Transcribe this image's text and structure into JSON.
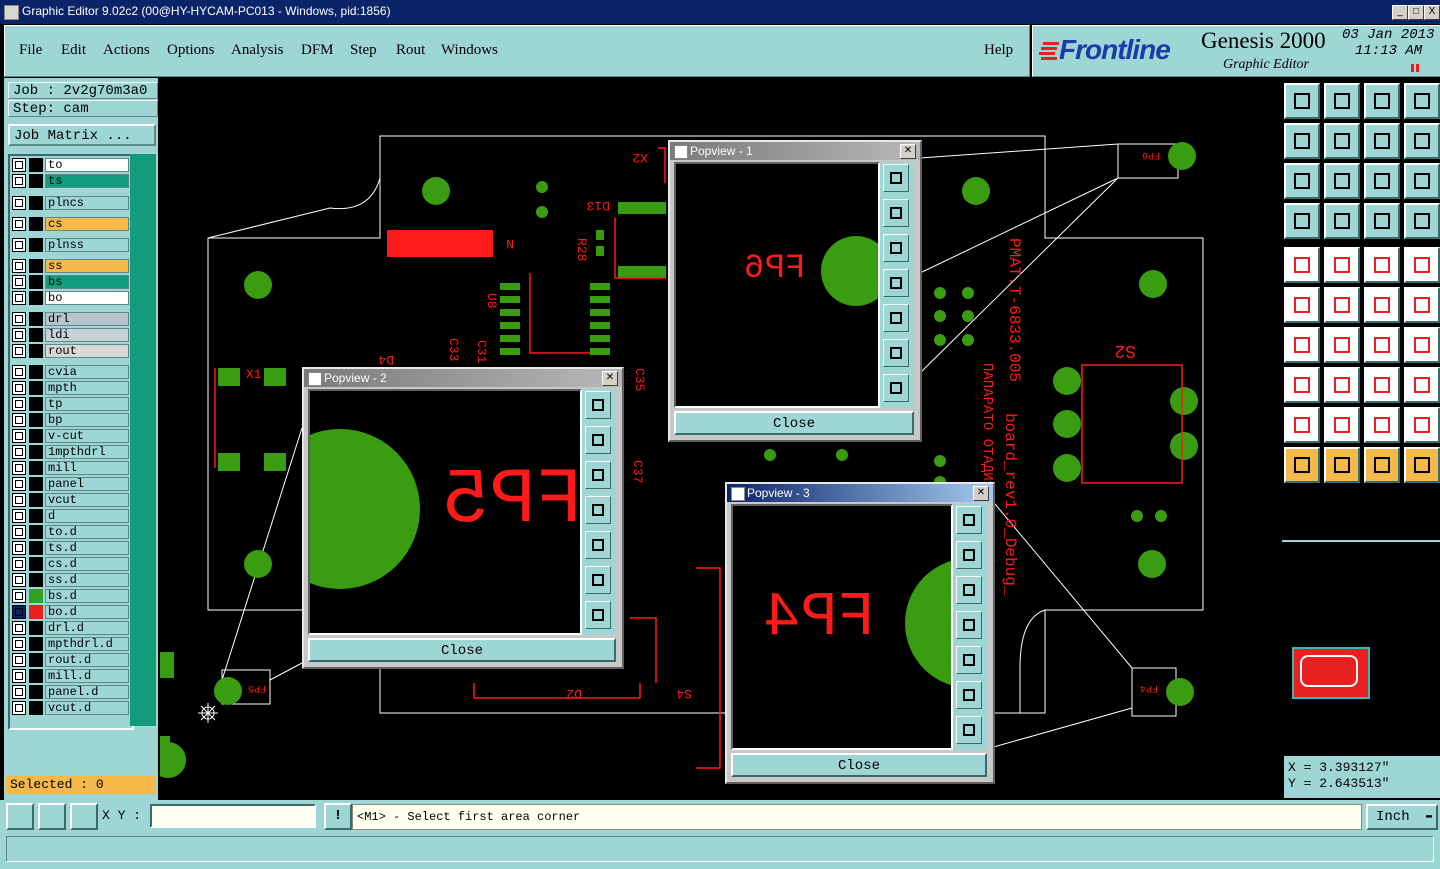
{
  "window": {
    "title": "Graphic Editor 9.02c2 (00@HY-HYCAM-PC013 - Windows, pid:1856)",
    "minimize": "_",
    "maximize": "□",
    "close": "X"
  },
  "menu": {
    "items": [
      "File",
      "Edit",
      "Actions",
      "Options",
      "Analysis",
      "DFM",
      "Step",
      "Rout",
      "Windows"
    ],
    "help": "Help"
  },
  "brand": {
    "logo": "Frontline",
    "product": "Genesis 2000",
    "subtitle": "Graphic Editor",
    "date": "03 Jan 2013",
    "time": "11:13 AM"
  },
  "job": {
    "job_label": "Job : 2v2g70m3a0",
    "step_label": "Step: cam",
    "matrix_button": "Job Matrix ..."
  },
  "layers": [
    {
      "name": "to",
      "color": "#ffffff",
      "sw": "#000000"
    },
    {
      "name": "ts",
      "color": "#139c7c",
      "sw": "#000000"
    },
    {
      "name": "plncs",
      "color": "#9ed6d6",
      "sw": "#000000"
    },
    {
      "name": "cs",
      "color": "#f5b84a",
      "sw": "#000000"
    },
    {
      "name": "plnss",
      "color": "#9ed6d6",
      "sw": "#000000"
    },
    {
      "name": "ss",
      "color": "#f5b84a",
      "sw": "#000000"
    },
    {
      "name": "bs",
      "color": "#139c7c",
      "sw": "#000000"
    },
    {
      "name": "bo",
      "color": "#ffffff",
      "sw": "#000000"
    },
    {
      "name": "drl",
      "color": "#b8c4cc",
      "sw": "#000000"
    },
    {
      "name": "ldi",
      "color": "#c8d0d8",
      "sw": "#000000"
    },
    {
      "name": "rout",
      "color": "#d8d8d8",
      "sw": "#000000"
    },
    {
      "name": "cvia",
      "color": "#9ed6d6",
      "sw": "#000000"
    },
    {
      "name": "mpth",
      "color": "#9ed6d6",
      "sw": "#000000"
    },
    {
      "name": "tp",
      "color": "#9ed6d6",
      "sw": "#000000"
    },
    {
      "name": "bp",
      "color": "#9ed6d6",
      "sw": "#000000"
    },
    {
      "name": "v-cut",
      "color": "#9ed6d6",
      "sw": "#000000"
    },
    {
      "name": "1mpthdrl",
      "color": "#9ed6d6",
      "sw": "#000000"
    },
    {
      "name": "mill",
      "color": "#9ed6d6",
      "sw": "#000000"
    },
    {
      "name": "panel",
      "color": "#9ed6d6",
      "sw": "#000000"
    },
    {
      "name": "vcut",
      "color": "#9ed6d6",
      "sw": "#000000"
    },
    {
      "name": "d",
      "color": "#9ed6d6",
      "sw": "#000000"
    },
    {
      "name": "to.d",
      "color": "#9ed6d6",
      "sw": "#000000"
    },
    {
      "name": "ts.d",
      "color": "#9ed6d6",
      "sw": "#000000"
    },
    {
      "name": "cs.d",
      "color": "#9ed6d6",
      "sw": "#000000"
    },
    {
      "name": "ss.d",
      "color": "#9ed6d6",
      "sw": "#000000"
    },
    {
      "name": "bs.d",
      "color": "#9ed6d6",
      "sw": "#33a020"
    },
    {
      "name": "bo.d",
      "color": "#9ed6d6",
      "sw": "#e82020"
    },
    {
      "name": "drl.d",
      "color": "#9ed6d6",
      "sw": "#000000"
    },
    {
      "name": "mpthdrl.d",
      "color": "#9ed6d6",
      "sw": "#000000"
    },
    {
      "name": "rout.d",
      "color": "#9ed6d6",
      "sw": "#000000"
    },
    {
      "name": "mill.d",
      "color": "#9ed6d6",
      "sw": "#000000"
    },
    {
      "name": "panel.d",
      "color": "#9ed6d6",
      "sw": "#000000"
    },
    {
      "name": "vcut.d",
      "color": "#9ed6d6",
      "sw": "#000000"
    }
  ],
  "selected_label": "Selected : 0",
  "canvas_labels": {
    "x2": "X2",
    "d13": "D13",
    "r28": "R28",
    "u8": "U8",
    "c33": "C33",
    "c31": "C31",
    "d4": "D4",
    "x1": "X1",
    "c35": "C35",
    "c37": "C37",
    "s2": "S2",
    "d2": "D2",
    "s4": "S4",
    "n": "N",
    "fp6_small": "FP6",
    "fp5_small": "FP5",
    "fp4_small": "FP4",
    "board_text1": "PMAT.T-6833.005",
    "board_text2": "ПАПАРАТО ОТАДИЯ",
    "board_text3": "board_rev1.0_Debug_"
  },
  "popups": [
    {
      "title": "Popview - 1",
      "label": "FP6",
      "close": "Close"
    },
    {
      "title": "Popview - 2",
      "label": "FP5",
      "close": "Close"
    },
    {
      "title": "Popview - 3",
      "label": "FP4",
      "close": "Close"
    }
  ],
  "coords": {
    "x": "X = 3.393127\"",
    "y": "Y = 2.643513\""
  },
  "bottom": {
    "xy_label": "X Y :",
    "xy_value": "",
    "bang": "!",
    "prompt": "<M1> - Select first area corner",
    "units": "Inch",
    "units_arrow": "▬"
  },
  "colors": {
    "panel": "#9ed6d6",
    "copper": "#3a9c10",
    "silk": "#ff1a1a",
    "outline": "#ffffff",
    "titlebar": "#0a246a"
  }
}
